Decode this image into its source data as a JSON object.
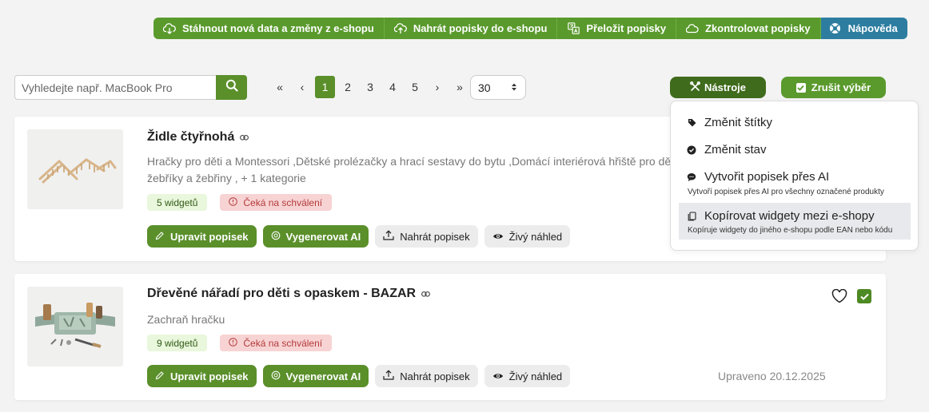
{
  "toolbar": {
    "download_label": "Stáhnout nová data a změny z e-shopu",
    "upload_label": "Nahrát popisky do e-shopu",
    "translate_label": "Přeložit popisky",
    "check_label": "Zkontrolovat popisky",
    "help_label": "Nápověda"
  },
  "search": {
    "placeholder": "Vyhledejte např. MacBook Pro",
    "value": ""
  },
  "pagination": {
    "first": "«",
    "prev": "‹",
    "pages": [
      "1",
      "2",
      "3",
      "4",
      "5"
    ],
    "current": "1",
    "next": "›",
    "last": "»",
    "per_page": "30"
  },
  "tools": {
    "tools_label": "Nástroje",
    "cancel_selection_label": "Zrušit výběr"
  },
  "dropdown": {
    "items": [
      {
        "label": "Změnit štítky",
        "icon": "tag-icon",
        "desc": ""
      },
      {
        "label": "Změnit stav",
        "icon": "check-circle-icon",
        "desc": ""
      },
      {
        "label": "Vytvořit popisek přes AI",
        "icon": "chat-icon",
        "desc": "Vytvoří popisek přes AI pro všechny označené produkty"
      },
      {
        "label": "Kopírovat widgety mezi e-shopy",
        "icon": "copy-icon",
        "desc": "Kopíruje widgety do jiného e-shopu podle EAN nebo kódu"
      }
    ]
  },
  "products": [
    {
      "title": "Židle čtyřnohá",
      "categories": "Hračky pro děti a Montessori ,Dětské prolézačky a hrací sestavy do bytu ,Domácí interiérová hřiště pro děti ,",
      "categories_line2": "žebříky a žebřiny , + 1 kategorie",
      "widgets": "5 widgetů",
      "status": "Čeká na schválení",
      "edited": ""
    },
    {
      "title": "Dřevěné nářadí pro děti s opaskem - BAZAR",
      "categories": "Zachraň hračku",
      "widgets": "9 widgetů",
      "status": "Čeká na schválení",
      "edited": "Upraveno 20.12.2025"
    }
  ],
  "card_actions": {
    "edit": "Upravit popisek",
    "generate": "Vygenerovat AI",
    "upload": "Nahrát popisek",
    "preview": "Živý náhled"
  },
  "colors": {
    "primary_green": "#5a8f2a",
    "dark_green": "#3f6b1c",
    "help_blue": "#2c7da0",
    "status_red_bg": "#f8d3d3",
    "widget_green_bg": "#e9f7dc"
  }
}
